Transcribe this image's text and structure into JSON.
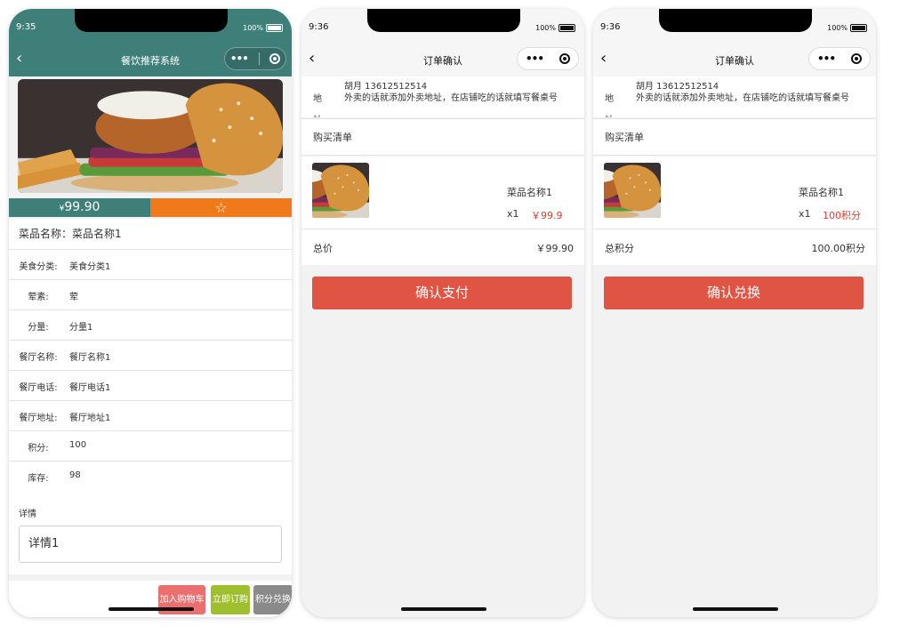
{
  "phone1": {
    "time": "9:35",
    "battery": "100%",
    "title": "餐饮推荐系统",
    "price_symbol": "¥",
    "price": "99.90",
    "name_label": "菜品名称：",
    "name_value": "菜品名称1",
    "fields": [
      {
        "label": "美食分类:",
        "value": "美食分类1"
      },
      {
        "label": "荤素:",
        "value": "荤"
      },
      {
        "label": "分量:",
        "value": "分量1"
      },
      {
        "label": "餐厅名称:",
        "value": "餐厅名称1"
      },
      {
        "label": "餐厅电话:",
        "value": "餐厅电话1"
      },
      {
        "label": "餐厅地址:",
        "value": "餐厅地址1"
      },
      {
        "label": "积分:",
        "value": "100"
      },
      {
        "label": "库存:",
        "value": "98"
      }
    ],
    "detail_title": "详情",
    "detail_value": "详情1",
    "btn_cart": "加入购物车",
    "btn_order": "立即订购",
    "btn_points": "积分兑换"
  },
  "phone2": {
    "time": "9:36",
    "battery": "100%",
    "title": "订单确认",
    "addr_label": "地",
    "addr_label2": "址",
    "addr_line1": "胡月 13612512514",
    "addr_line2": "外卖的话就添加外卖地址，在店铺吃的话就填写餐桌号",
    "list_title": "购买清单",
    "item_name": "菜品名称1",
    "item_qty": "x1",
    "item_price": "￥99.9",
    "total_label": "总价",
    "total_value": "￥99.90",
    "confirm": "确认支付"
  },
  "phone3": {
    "time": "9:36",
    "battery": "100%",
    "title": "订单确认",
    "addr_label": "地",
    "addr_label2": "址",
    "addr_line1": "胡月 13612512514",
    "addr_line2": "外卖的话就添加外卖地址，在店铺吃的话就填写餐桌号",
    "list_title": "购买清单",
    "item_name": "菜品名称1",
    "item_qty": "x1",
    "item_price": "100积分",
    "total_label": "总积分",
    "total_value": "100.00积分",
    "confirm": "确认兑换"
  },
  "icons": {
    "back": "chevron-left-icon",
    "more": "more-dots-icon",
    "close": "target-icon",
    "favorite": "star-icon"
  },
  "colors": {
    "teal": "#3f7f7a",
    "orange": "#f07a1a",
    "confirm_red": "#e05443",
    "price_red": "#e13b2f",
    "cart_pink": "#eb6f6f",
    "order_green": "#9fbf2f",
    "points_gray": "#8a8a8a"
  }
}
